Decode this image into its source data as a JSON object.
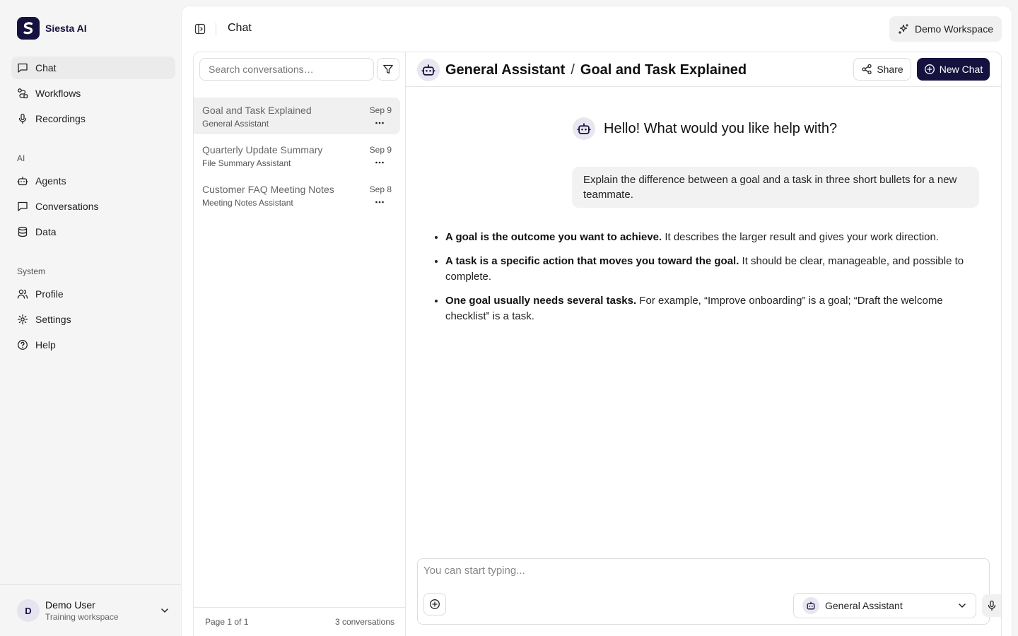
{
  "brand": {
    "name": "Siesta AI"
  },
  "sidebar": {
    "nav": [
      {
        "label": "Chat",
        "icon": "chat-icon",
        "active": true
      },
      {
        "label": "Workflows",
        "icon": "workflow-icon"
      },
      {
        "label": "Recordings",
        "icon": "mic-icon"
      }
    ],
    "ai_section": {
      "label": "AI",
      "items": [
        {
          "label": "Agents",
          "icon": "bot-icon"
        },
        {
          "label": "Conversations",
          "icon": "chat-icon"
        },
        {
          "label": "Data",
          "icon": "database-icon"
        }
      ]
    },
    "system_section": {
      "label": "System",
      "items": [
        {
          "label": "Profile",
          "icon": "users-icon"
        },
        {
          "label": "Settings",
          "icon": "gear-icon"
        },
        {
          "label": "Help",
          "icon": "help-circle-icon"
        }
      ]
    },
    "user": {
      "initial": "D",
      "name": "Demo User",
      "workspace": "Training workspace"
    }
  },
  "topbar": {
    "title": "Chat",
    "workspace_button": "Demo Workspace"
  },
  "conversations": {
    "search_placeholder": "Search conversations…",
    "items": [
      {
        "title": "Goal and Task Explained",
        "agent": "General Assistant",
        "date": "Sep 9",
        "active": true
      },
      {
        "title": "Quarterly Update Summary",
        "agent": "File Summary Assistant",
        "date": "Sep 9"
      },
      {
        "title": "Customer FAQ Meeting Notes",
        "agent": "Meeting Notes Assistant",
        "date": "Sep 8"
      }
    ],
    "footer": {
      "page": "Page 1 of 1",
      "count": "3 conversations"
    }
  },
  "chat": {
    "agent": "General Assistant",
    "separator": "/",
    "title": "Goal and Task Explained",
    "share_label": "Share",
    "new_chat_label": "New Chat",
    "greeting": "Hello! What would you like help with?",
    "user_message": "Explain the difference between a goal and a task in three short bullets for a new teammate.",
    "answer": [
      {
        "bold": "A goal is the outcome you want to achieve.",
        "text": " It describes the larger result and gives your work direction."
      },
      {
        "bold": "A task is a specific action that moves you toward the goal.",
        "text": " It should be clear, manageable, and possible to complete."
      },
      {
        "bold": "One goal usually needs several tasks.",
        "text": " For example, “Improve onboarding” is a goal; “Draft the welcome checklist” is a task."
      }
    ],
    "composer": {
      "placeholder": "You can start typing...",
      "agent_select": "General Assistant"
    }
  },
  "colors": {
    "brand": "#16123f",
    "panel": "#ffffff",
    "background": "#f5f5f5",
    "active_item": "#ebebeb"
  }
}
